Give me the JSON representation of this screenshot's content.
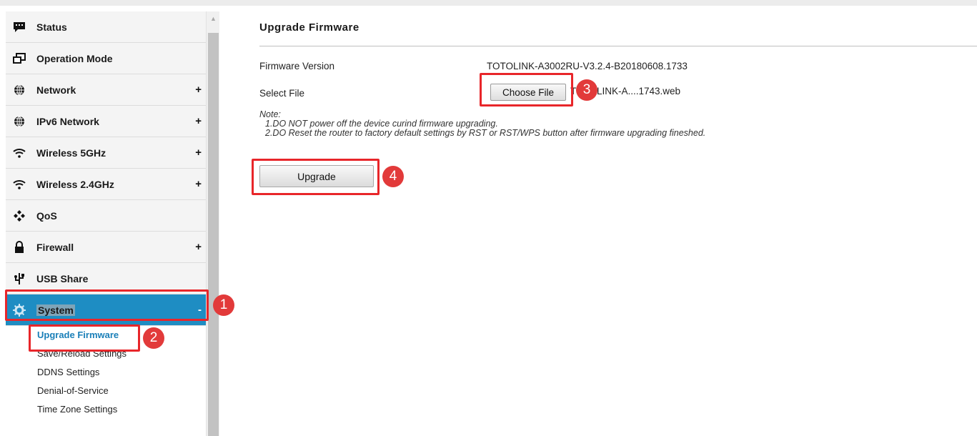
{
  "sidebar": {
    "menu": [
      {
        "label": "Status",
        "icon": "chat-bubble-icon",
        "expand": ""
      },
      {
        "label": "Operation Mode",
        "icon": "windows-icon",
        "expand": ""
      },
      {
        "label": "Network",
        "icon": "globe-icon",
        "expand": "+"
      },
      {
        "label": "IPv6 Network",
        "icon": "globe-icon",
        "expand": "+"
      },
      {
        "label": "Wireless 5GHz",
        "icon": "wifi-icon",
        "expand": "+"
      },
      {
        "label": "Wireless 2.4GHz",
        "icon": "wifi-icon",
        "expand": "+"
      },
      {
        "label": "QoS",
        "icon": "diamonds-icon",
        "expand": ""
      },
      {
        "label": "Firewall",
        "icon": "lock-icon",
        "expand": "+"
      },
      {
        "label": "USB Share",
        "icon": "usb-icon",
        "expand": ""
      },
      {
        "label": "System",
        "icon": "gear-icon",
        "expand": "-"
      }
    ],
    "submenu": [
      {
        "label": "Upgrade Firmware"
      },
      {
        "label": "Save/Reload Settings"
      },
      {
        "label": "DDNS Settings"
      },
      {
        "label": "Denial-of-Service"
      },
      {
        "label": "Time Zone Settings"
      }
    ]
  },
  "main": {
    "title": "Upgrade Firmware",
    "firmware_version_label": "Firmware Version",
    "firmware_version_value": "TOTOLINK-A3002RU-V3.2.4-B20180608.1733",
    "select_file_label": "Select File",
    "choose_file_button": "Choose File",
    "file_name": "TOTOLINK-A....1743.web",
    "note_title": "Note:",
    "note_line1": "1.DO NOT power off the device curind firmware upgrading.",
    "note_line2": "2.DO Reset the router to factory default settings by RST or RST/WPS button after firmware upgrading fineshed.",
    "upgrade_button": "Upgrade"
  },
  "annotations": {
    "badge1": "1",
    "badge2": "2",
    "badge3": "3",
    "badge4": "4",
    "highlight_color": "#e8262a"
  },
  "colors": {
    "active_menu_bg": "#1e8dc3",
    "current_sub_text": "#1a7fb8"
  }
}
